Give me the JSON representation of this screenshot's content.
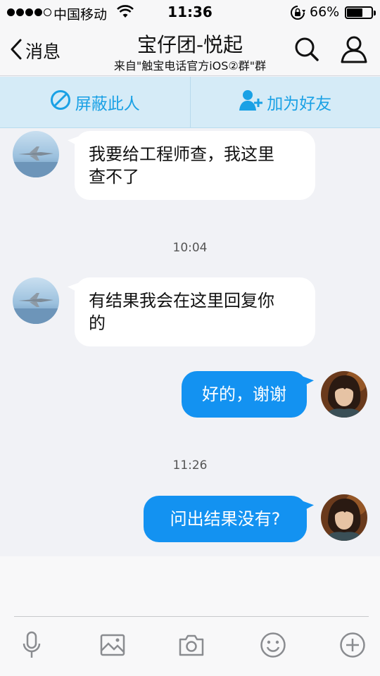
{
  "status_bar": {
    "carrier": "中国移动",
    "time": "11:36",
    "battery_pct": "66%",
    "battery_level": 0.66
  },
  "nav": {
    "back_label": "消息",
    "title": "宝仔团-悦起",
    "subtitle": "来自\"触宝电话官方iOS②群\"群"
  },
  "actions": {
    "block_label": "屏蔽此人",
    "add_friend_label": "加为好友"
  },
  "messages": [
    {
      "direction": "in",
      "text_line1": "我要给工程师查，我这里",
      "text_line2": "查不了"
    },
    {
      "timestamp": "10:04"
    },
    {
      "direction": "in",
      "text_line1": "有结果我会在这里回复你",
      "text_line2": "的"
    },
    {
      "direction": "out",
      "text": "好的，谢谢"
    },
    {
      "timestamp": "11:26"
    },
    {
      "direction": "out",
      "text": "问出结果没有?"
    }
  ],
  "toolbar": {
    "items": [
      "microphone-icon",
      "image-icon",
      "camera-icon",
      "emoji-icon",
      "plus-icon"
    ]
  },
  "colors": {
    "accent": "#1aa1e5",
    "outgoing_bubble": "#1392f1",
    "action_bar_bg": "#d5ebf7",
    "chat_bg": "#f1f2f6"
  }
}
